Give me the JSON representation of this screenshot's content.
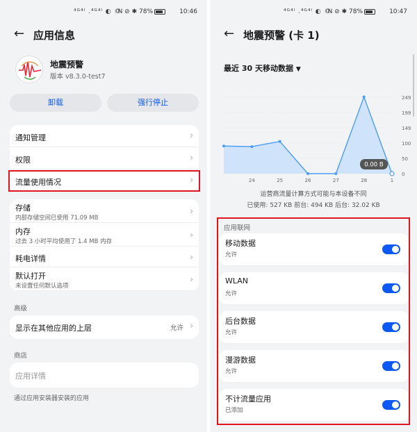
{
  "left": {
    "status": {
      "icons": "⁴ᴳ⁴ˡ .⁴ᴳ⁴ˡ ◐ ©",
      "right_icons": "N ⊘ ✱ 78%",
      "time": "10:46"
    },
    "title": "应用信息",
    "app": {
      "name": "地震预警",
      "version": "版本 v8.3.0-test7"
    },
    "buttons": {
      "uninstall": "卸载",
      "force_stop": "强行停止"
    },
    "group1": [
      "通知管理",
      "权限",
      "流量使用情况"
    ],
    "group2": [
      {
        "label": "存储",
        "sub": "内部存储空间已使用 71.09 MB"
      },
      {
        "label": "内存",
        "sub": "过去 3 小时平均使用了 1.4 MB 内存"
      },
      {
        "label": "耗电详情",
        "sub": ""
      },
      {
        "label": "默认打开",
        "sub": "未设置任何默认选项"
      }
    ],
    "advanced_header": "高级",
    "overlay": {
      "label": "显示在其他应用的上层",
      "value": "允许"
    },
    "store_header": "商店",
    "store_item": "应用详情",
    "store_note": "通过应用安装器安装的应用"
  },
  "right": {
    "status": {
      "icons": "⁴ᴳ⁴ˡ .⁴ᴳ⁴ˡ ◐ ©",
      "right_icons": "N ⊘ ✱ 78%",
      "time": "10:47"
    },
    "title": "地震预警 (卡 1)",
    "period": "最近 30 天移动数据",
    "tooltip": "0.00 B",
    "note1": "运营商流量计算方式可能与本设备不同",
    "note2": "已使用: 527 KB 前台: 494 KB 后台: 32.02 KB",
    "network_header": "应用联网",
    "toggles": [
      {
        "label": "移动数据",
        "sub": "允许",
        "on": true
      },
      {
        "label": "WLAN",
        "sub": "允许",
        "on": true
      },
      {
        "label": "后台数据",
        "sub": "允许",
        "on": true
      },
      {
        "label": "漫游数据",
        "sub": "允许",
        "on": true
      },
      {
        "label": "不计流量应用",
        "sub": "已添加",
        "on": true
      }
    ]
  },
  "chart_data": {
    "type": "area",
    "x_ticks": [
      "24",
      "25",
      "26",
      "27",
      "28",
      "1"
    ],
    "y_ticks": [
      "249",
      "199",
      "149",
      "100",
      "50",
      "0"
    ],
    "x": [
      23,
      24,
      25,
      26,
      27,
      28,
      1
    ],
    "values": [
      90,
      88,
      105,
      0,
      0,
      250,
      0
    ],
    "ylim": [
      0,
      249
    ],
    "color": "#4d9df3"
  }
}
